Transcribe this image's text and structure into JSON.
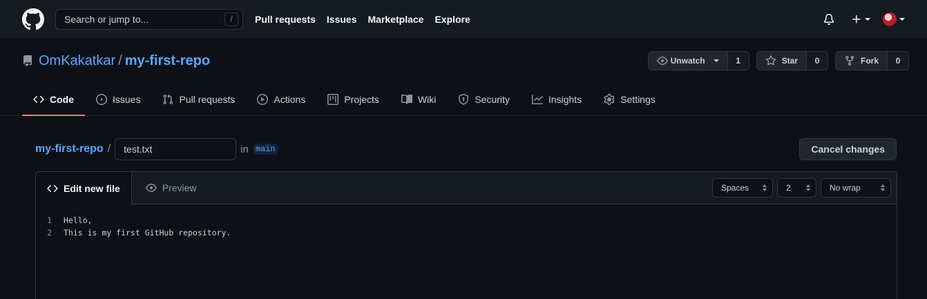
{
  "header": {
    "search_placeholder": "Search or jump to...",
    "slash_key": "/",
    "nav": [
      "Pull requests",
      "Issues",
      "Marketplace",
      "Explore"
    ]
  },
  "repo": {
    "owner": "OmKakatkar",
    "separator": "/",
    "name": "my-first-repo",
    "watch": {
      "label": "Unwatch",
      "count": "1"
    },
    "star": {
      "label": "Star",
      "count": "0"
    },
    "fork": {
      "label": "Fork",
      "count": "0"
    }
  },
  "tabs": [
    "Code",
    "Issues",
    "Pull requests",
    "Actions",
    "Projects",
    "Wiki",
    "Security",
    "Insights",
    "Settings"
  ],
  "editor": {
    "crumb": "my-first-repo",
    "crumb_sep": "/",
    "filename": "test.txt",
    "in_label": "in",
    "branch": "main",
    "cancel_label": "Cancel changes",
    "tab_edit": "Edit new file",
    "tab_preview": "Preview",
    "indent_mode": "Spaces",
    "indent_size": "2",
    "wrap_mode": "No wrap",
    "lines": [
      {
        "n": "1",
        "text": "Hello,"
      },
      {
        "n": "2",
        "text": "This is my first GitHub repository."
      }
    ]
  },
  "colors": {
    "accent": "#58a6ff",
    "tab_underline": "#f78166",
    "bg": "#0d1117",
    "header_bg": "#161b22"
  }
}
